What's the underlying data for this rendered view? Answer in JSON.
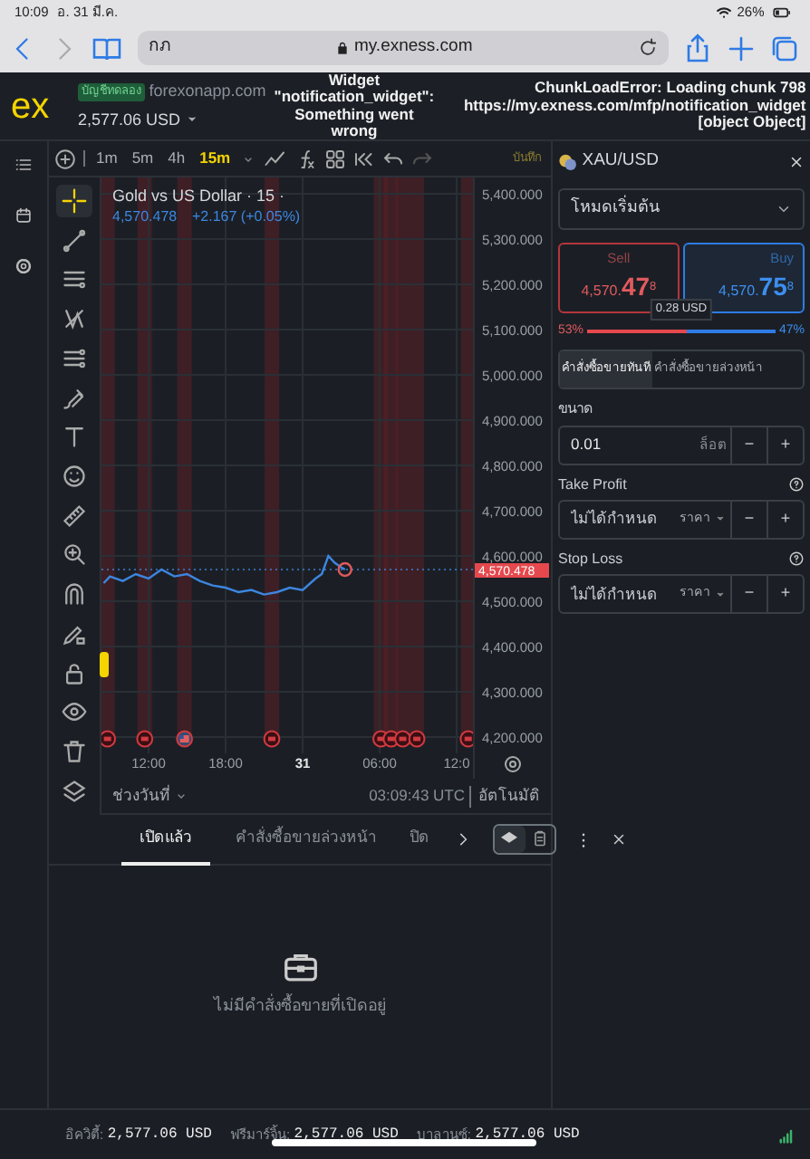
{
  "device_status": {
    "time": "10:09",
    "date": "อ. 31 มี.ค.",
    "battery": "26%"
  },
  "browser": {
    "tab_text": "กภ",
    "url": "my.exness.com"
  },
  "header": {
    "logo": "ex",
    "account_badge": "บัญชีทดลอง",
    "server": "forexonapp.com",
    "balance": "2,577.06 USD",
    "widget_error": [
      "Widget",
      "\"notification_widget\":",
      "Something went",
      "wrong"
    ],
    "chunk_error": [
      "ChunkLoadError: Loading chunk 798",
      "https://my.exness.com/mfp/notification_widget",
      "[object Object]"
    ]
  },
  "chart_toolbar": {
    "timeframes": [
      {
        "label": "1m",
        "selected": false
      },
      {
        "label": "5m",
        "selected": false
      },
      {
        "label": "4h",
        "selected": false
      },
      {
        "label": "15m",
        "selected": true
      }
    ],
    "save": "บันทึก"
  },
  "drawing_tools": [
    {
      "kind": "crosshair",
      "selected": true
    },
    {
      "kind": "trendline",
      "selected": false
    },
    {
      "kind": "parallel",
      "selected": false
    },
    {
      "kind": "pattern",
      "selected": false
    },
    {
      "kind": "fib",
      "selected": false
    },
    {
      "kind": "brush",
      "selected": false
    },
    {
      "kind": "text",
      "selected": false
    },
    {
      "kind": "emoji",
      "selected": false
    },
    {
      "kind": "ruler",
      "selected": false
    },
    {
      "kind": "zoom",
      "selected": false
    },
    {
      "kind": "magnet",
      "selected": false
    },
    {
      "kind": "pencil",
      "selected": false
    },
    {
      "kind": "lock",
      "selected": false
    },
    {
      "kind": "eye",
      "selected": false
    },
    {
      "kind": "trash",
      "selected": false
    },
    {
      "kind": "layers",
      "selected": false
    }
  ],
  "chart": {
    "legend_title": "Gold vs US Dollar · 15 ·",
    "legend_price": "4,570.478",
    "legend_change": "+2.167 (+0.05%)",
    "price_tag": "4,570.478",
    "next_day_labels": [
      "31",
      "06:00",
      "12:0"
    ],
    "date_range": "ช่วงวันที่",
    "clock": "03:09:43 UTC",
    "auto": "อัตโนมัติ",
    "chart_data": {
      "type": "line",
      "x": [
        8.5,
        9,
        10,
        11,
        12,
        13,
        14,
        15,
        16,
        17,
        18,
        19,
        20,
        21,
        22,
        23,
        24,
        25,
        25.5,
        26,
        26.5,
        27,
        27.3
      ],
      "series": [
        {
          "color": "#3d86e0",
          "values": [
            4540,
            4555,
            4545,
            4560,
            4550,
            4570,
            4555,
            4560,
            4545,
            4535,
            4530,
            4520,
            4525,
            4515,
            4520,
            4530,
            4525,
            4550,
            4560,
            4600,
            4585,
            4575,
            4570
          ]
        }
      ],
      "xlim": [
        8.33,
        37.27
      ],
      "ylim": [
        4164,
        5436
      ],
      "grid": true,
      "xticks": [
        {
          "value": 12,
          "label": "12:00"
        },
        {
          "value": 18,
          "label": "18:00"
        }
      ],
      "yticks": [
        {
          "value": 5400,
          "label": "5,400.000"
        },
        {
          "value": 5300,
          "label": "5,300.000"
        },
        {
          "value": 5200,
          "label": "5,200.000"
        },
        {
          "value": 5100,
          "label": "5,100.000"
        },
        {
          "value": 5000,
          "label": "5,000.000"
        },
        {
          "value": 4900,
          "label": "4,900.000"
        },
        {
          "value": 4800,
          "label": "4,800.000"
        },
        {
          "value": 4700,
          "label": "4,700.000"
        },
        {
          "value": 4600,
          "label": "4,600.000"
        },
        {
          "value": 4500,
          "label": "4,500.000"
        },
        {
          "value": 4400,
          "label": "4,400.000"
        },
        {
          "value": 4300,
          "label": "4,300.000"
        },
        {
          "value": 4200,
          "label": "4,200.000"
        }
      ]
    }
  },
  "order_panel": {
    "symbol": "XAU/USD",
    "mode": "โหมดเริ่มต้น",
    "sell": {
      "label": "Sell",
      "price_main": "4,570.",
      "price_big": "47",
      "price_sup": "8"
    },
    "buy": {
      "label": "Buy",
      "price_main": "4,570.",
      "price_big": "75",
      "price_sup": "8"
    },
    "spread": "0.28 USD",
    "sentiment": {
      "sell": "53%",
      "buy": "47%",
      "level": 0.53
    },
    "order_types": [
      {
        "label": "คำสั่งซื้อขายทันที",
        "selected": true
      },
      {
        "label": "คำสั่งซื้อขายล่วงหน้า",
        "selected": false
      }
    ],
    "volume": {
      "label": "ขนาด",
      "value": "0.01",
      "unit": "ล็อต",
      "minus": "−",
      "plus": "+"
    },
    "take_profit": {
      "label": "Take Profit",
      "placeholder": "ไม่ได้กำหนด",
      "mode": "ราคา",
      "minus": "−",
      "plus": "+"
    },
    "stop_loss": {
      "label": "Stop Loss",
      "placeholder": "ไม่ได้กำหนด",
      "mode": "ราคา",
      "minus": "−",
      "plus": "+"
    }
  },
  "positions_panel": {
    "tabs": [
      {
        "label": "เปิดแล้ว",
        "selected": true
      },
      {
        "label": "คำสั่งซื้อขายล่วงหน้า",
        "selected": false
      },
      {
        "label": "ปิด",
        "selected": false
      }
    ],
    "empty_text": "ไม่มีคำสั่งซื้อขายที่เปิดอยู่"
  },
  "footer": {
    "items": [
      {
        "label": "อิควิตี้:",
        "value": "2,577.06 USD"
      },
      {
        "label": "ฟรีมาร์จิ้น:",
        "value": "2,577.06 USD"
      },
      {
        "label": "บาลานซ์:",
        "value": "2,577.06 USD"
      }
    ]
  }
}
